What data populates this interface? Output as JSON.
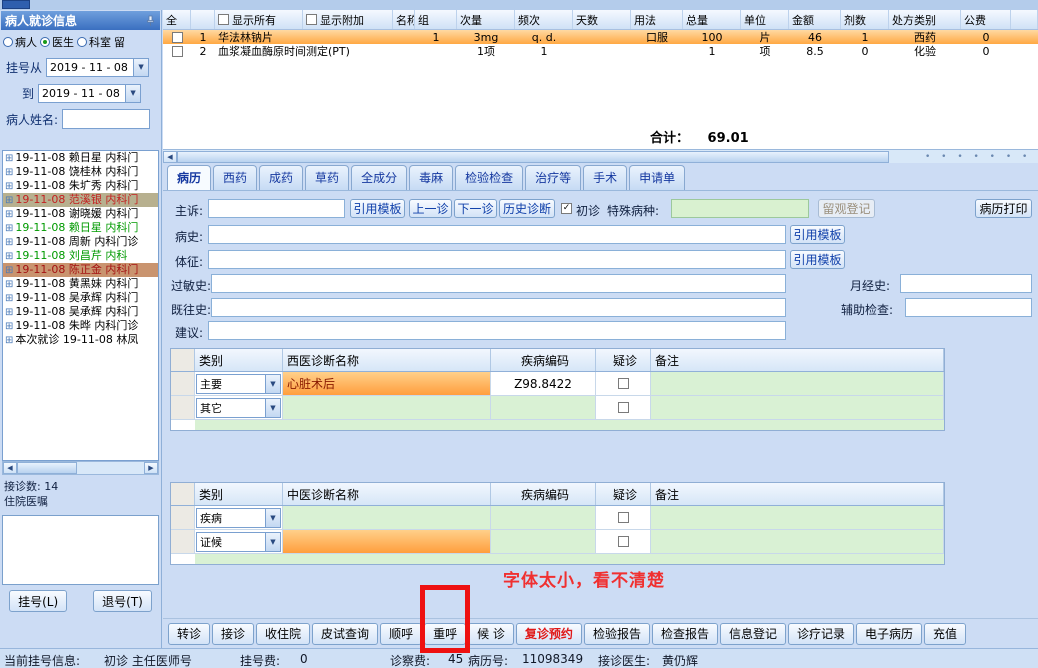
{
  "left_panel": {
    "title": "病人就诊信息",
    "filter_radios": [
      {
        "label": "病人",
        "cls": ""
      },
      {
        "label": "医生",
        "cls": "checked"
      },
      {
        "label": "科室",
        "cls": ""
      }
    ],
    "trailing_label": "留",
    "date_from_label": "挂号从",
    "date_from_value": "2019 - 11 - 08",
    "date_to_label": "到",
    "date_to_value": "2019 - 11 - 08",
    "patient_name_label": "病人姓名:",
    "patients": [
      {
        "text": "19-11-08 赖日星 内科门",
        "color": "#000000",
        "bg": "transparent"
      },
      {
        "text": "19-11-08 饶桂林 内科门",
        "color": "#000000",
        "bg": "transparent"
      },
      {
        "text": "19-11-08 朱圹秀 内科门",
        "color": "#000000",
        "bg": "transparent"
      },
      {
        "text": "19-11-08 范溪银 内科门",
        "color": "#c42020",
        "bg": "#b7b08f"
      },
      {
        "text": "19-11-08 谢晓媛 内科门",
        "color": "#000000",
        "bg": "transparent"
      },
      {
        "text": "19-11-08 赖日星 内科门",
        "color": "#009a00",
        "bg": "transparent"
      },
      {
        "text": "19-11-08 周新 内科门诊",
        "color": "#000000",
        "bg": "transparent"
      },
      {
        "text": "19-11-08 刘昌芹 内科",
        "color": "#009a00",
        "bg": "transparent"
      },
      {
        "text": "19-11-08 陈正金 内科门",
        "color": "#a51212",
        "bg": "#c9946f"
      },
      {
        "text": "19-11-08 黄黑妹 内科门",
        "color": "#000000",
        "bg": "transparent"
      },
      {
        "text": "19-11-08 吴承辉 内科门",
        "color": "#000000",
        "bg": "transparent"
      },
      {
        "text": "19-11-08 吴承辉 内科门",
        "color": "#000000",
        "bg": "transparent"
      },
      {
        "text": "19-11-08 朱晔 内科门诊",
        "color": "#000000",
        "bg": "transparent"
      },
      {
        "text": "本次就诊 19-11-08 林凤",
        "color": "#000000",
        "bg": "transparent"
      }
    ],
    "stats_line1": "接诊数: 14",
    "stats_line2": "住院医嘱",
    "register_button": "挂号(L)",
    "cancel_button": "退号(T)"
  },
  "rx_grid": {
    "headers": {
      "all": "全",
      "show_all": "显示所有",
      "show_extra": "显示附加",
      "name": "名称",
      "group": "组",
      "dose": "次量",
      "freq": "频次",
      "days": "天数",
      "usage": "用法",
      "total": "总量",
      "unit": "单位",
      "amount": "金额",
      "doses": "剂数",
      "rx_type": "处方类别",
      "public_fee": "公费"
    },
    "rows": [
      {
        "seq": "1",
        "name": "华法林钠片",
        "group": "1",
        "dose": "3mg",
        "freq": "q. d.",
        "days": "",
        "usage": "口服",
        "total": "100",
        "unit": "片",
        "amount": "46",
        "doses": "1",
        "rx_type": "西药",
        "public_fee": "0"
      },
      {
        "seq": "2",
        "name": "血浆凝血酶原时间测定(PT)",
        "group": "",
        "dose": "1项",
        "freq": "1",
        "days": "",
        "usage": "",
        "total": "1",
        "unit": "项",
        "amount": "8.5",
        "doses": "0",
        "rx_type": "化验",
        "public_fee": "0"
      }
    ],
    "total_label": "合计：",
    "total_value": "69.01"
  },
  "tabs": [
    {
      "label": "病历",
      "cls": "active"
    },
    {
      "label": "西药",
      "cls": ""
    },
    {
      "label": "成药",
      "cls": ""
    },
    {
      "label": "草药",
      "cls": ""
    },
    {
      "label": "全成分",
      "cls": ""
    },
    {
      "label": "毒麻",
      "cls": ""
    },
    {
      "label": "检验检查",
      "cls": ""
    },
    {
      "label": "治疗等",
      "cls": ""
    },
    {
      "label": "手术",
      "cls": ""
    },
    {
      "label": "申请单",
      "cls": ""
    }
  ],
  "record_form": {
    "chief_label": "主诉:",
    "cite_template": "引用模板",
    "prev_visit": "上一诊",
    "next_visit": "下一诊",
    "history_diag": "历史诊断",
    "first_visit_label": "初诊",
    "first_visit_mark": "✓",
    "special_disease_label": "特殊病种:",
    "observe_register": "留观登记",
    "print_record": "病历打印",
    "history_label": "病史:",
    "signs_label": "体征:",
    "allergy_label": "过敏史:",
    "menstrual_label": "月经史:",
    "past_label": "既往史:",
    "aux_exam_label": "辅助检查:",
    "advice_label": "建议:"
  },
  "west_diag": {
    "headers": {
      "category": "类别",
      "name": "西医诊断名称",
      "code": "疾病编码",
      "suspected": "疑诊",
      "note": "备注"
    },
    "rows": [
      {
        "category": "主要",
        "name": "心脏术后",
        "code": "Z98.8422",
        "note": ""
      },
      {
        "category": "其它",
        "name": "",
        "code": "",
        "note": ""
      }
    ]
  },
  "tcm_diag": {
    "headers": {
      "category": "类别",
      "name": "中医诊断名称",
      "code": "疾病编码",
      "suspected": "疑诊",
      "note": "备注"
    },
    "rows": [
      {
        "category": "疾病",
        "name": "",
        "code": "",
        "note": ""
      },
      {
        "category": "证候",
        "name": "",
        "code": "",
        "note": ""
      }
    ]
  },
  "annotation": {
    "text": "字体太小，看不清楚"
  },
  "bottom_bar": {
    "buttons": [
      {
        "label": "转诊",
        "cls": ""
      },
      {
        "label": "接诊",
        "cls": ""
      },
      {
        "label": "收住院",
        "cls": ""
      },
      {
        "label": "皮试查询",
        "cls": ""
      },
      {
        "label": "顺呼",
        "cls": ""
      },
      {
        "label": "重呼",
        "cls": ""
      },
      {
        "label": "候 诊",
        "cls": ""
      },
      {
        "label": "复诊预约",
        "cls": "red-text"
      },
      {
        "label": "检验报告",
        "cls": ""
      },
      {
        "label": "检查报告",
        "cls": ""
      },
      {
        "label": "信息登记",
        "cls": ""
      },
      {
        "label": "诊疗记录",
        "cls": ""
      },
      {
        "label": "电子病历",
        "cls": ""
      },
      {
        "label": "充值",
        "cls": ""
      }
    ]
  },
  "status_bar": {
    "reg_info_label": "当前挂号信息:",
    "reg_info_value": "初诊 主任医师号",
    "reg_fee_label": "挂号费:",
    "reg_fee_value": "0",
    "exam_fee_label": "诊察费:",
    "exam_fee_value": "45",
    "record_no_label": "病历号:",
    "record_no_value": "11098349",
    "doctor_label": "接诊医生:",
    "doctor_value": "黄仍辉"
  }
}
